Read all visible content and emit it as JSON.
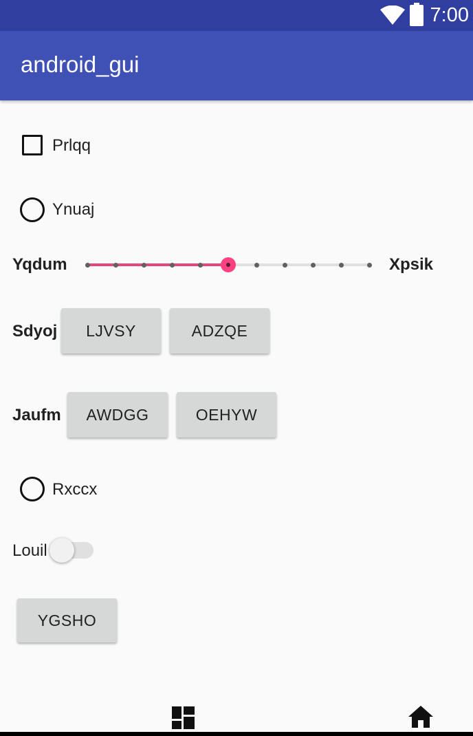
{
  "status_bar": {
    "time": "7:00",
    "wifi_icon": "wifi-icon",
    "battery_icon": "battery-full-icon"
  },
  "app_bar": {
    "title": "android_gui"
  },
  "checkbox_1": {
    "label": "Prlqq",
    "checked": false
  },
  "radio_1": {
    "label": "Ynuaj",
    "selected": false
  },
  "seekbar": {
    "left_label": "Yqdum",
    "right_label": "Xpsik",
    "ticks": 11,
    "value_index": 5,
    "accent_color": "#ff4081"
  },
  "row_sdyoj": {
    "label": "Sdyoj",
    "buttons": [
      "LJVSY",
      "ADZQE"
    ]
  },
  "row_jaufm": {
    "label": "Jaufm",
    "buttons": [
      "AWDGG",
      "OEHYW"
    ]
  },
  "radio_2": {
    "label": "Rxccx",
    "selected": false
  },
  "switch_1": {
    "label": "Louil",
    "on": false
  },
  "standalone_button": {
    "label": "YGSHO"
  },
  "nav_bar": {
    "recents_icon": "dashboard-icon",
    "home_icon": "home-icon"
  },
  "colors": {
    "status_bar": "#303f9f",
    "app_bar": "#3f51b5",
    "accent": "#ff4081",
    "button": "#d6d7d7"
  }
}
